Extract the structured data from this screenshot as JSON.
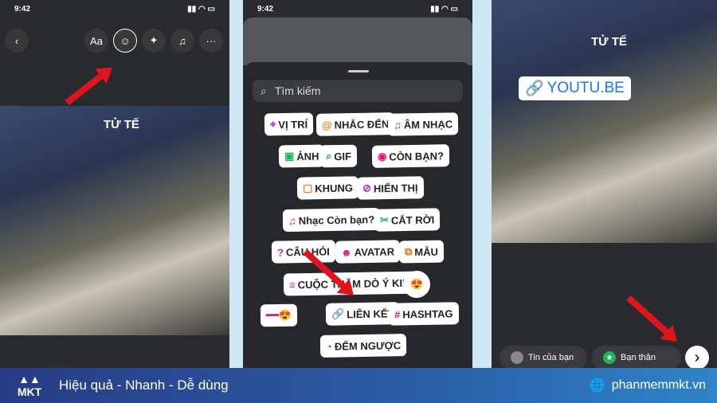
{
  "status_time": "9:42",
  "left": {
    "toolbar": [
      "Aa",
      "sticker",
      "✦",
      "♫",
      "···"
    ],
    "photo_sign": "TỬ TẾ"
  },
  "middle": {
    "search_placeholder": "Tìm kiếm",
    "stickers": [
      {
        "label": "VỊ TRÍ",
        "icon": "location-icon",
        "color": "#8a3ffc"
      },
      {
        "label": "NHẮC ĐẾN",
        "icon": "mention-icon",
        "color": "#f07b22"
      },
      {
        "label": "ÂM NHẠC",
        "icon": "music-icon",
        "color": "#e0177a"
      },
      {
        "label": "ẢNH",
        "icon": "image-icon",
        "color": "#22b35a"
      },
      {
        "label": "GIF",
        "icon": "search-icon",
        "color": "#22b35a"
      },
      {
        "label": "CÒN BẠN?",
        "icon": "camera-icon",
        "color": "#e0177a"
      },
      {
        "label": "KHUNG",
        "icon": "frame-icon",
        "color": "#f07b22"
      },
      {
        "label": "HIỂN THỊ",
        "icon": "eye-off-icon",
        "color": "#b026c9"
      },
      {
        "label": "Nhạc Còn bạn?",
        "icon": "music-plus-icon",
        "color": "#e0177a"
      },
      {
        "label": "CẮT RỜI",
        "icon": "scissors-icon",
        "color": "#22b35a"
      },
      {
        "label": "CÂU HỎI",
        "icon": "question-icon",
        "color": "#b026c9"
      },
      {
        "label": "AVATAR",
        "icon": "avatar-icon",
        "color": "#e0177a"
      },
      {
        "label": "MẪU",
        "icon": "template-icon",
        "color": "#f07b22"
      },
      {
        "label": "CUỘC THĂM DÒ Ý KIẾN",
        "icon": "poll-icon",
        "color": "#b026c9"
      },
      {
        "label": "",
        "icon": "emoji-heart-eyes-icon",
        "color": "#f5b400"
      },
      {
        "label": "",
        "icon": "emoji-slider-icon",
        "color": "#e0177a"
      },
      {
        "label": "LIÊN KẾT",
        "icon": "link-icon",
        "color": "#1877f2"
      },
      {
        "label": "HASHTAG",
        "icon": "hashtag-icon",
        "color": "#e0177a"
      },
      {
        "label": "ĐẾM NGƯỢC",
        "icon": "countdown-icon",
        "color": "#b026c9"
      }
    ]
  },
  "right": {
    "link_sticker": "YOUTU.BE",
    "share_your_story": "Tin của bạn",
    "close_friends": "Bạn thân",
    "next": "›"
  },
  "footer": {
    "brand": "MKT",
    "tagline": "Hiệu quả - Nhanh - Dễ dùng",
    "website": "phanmemmkt.vn"
  }
}
